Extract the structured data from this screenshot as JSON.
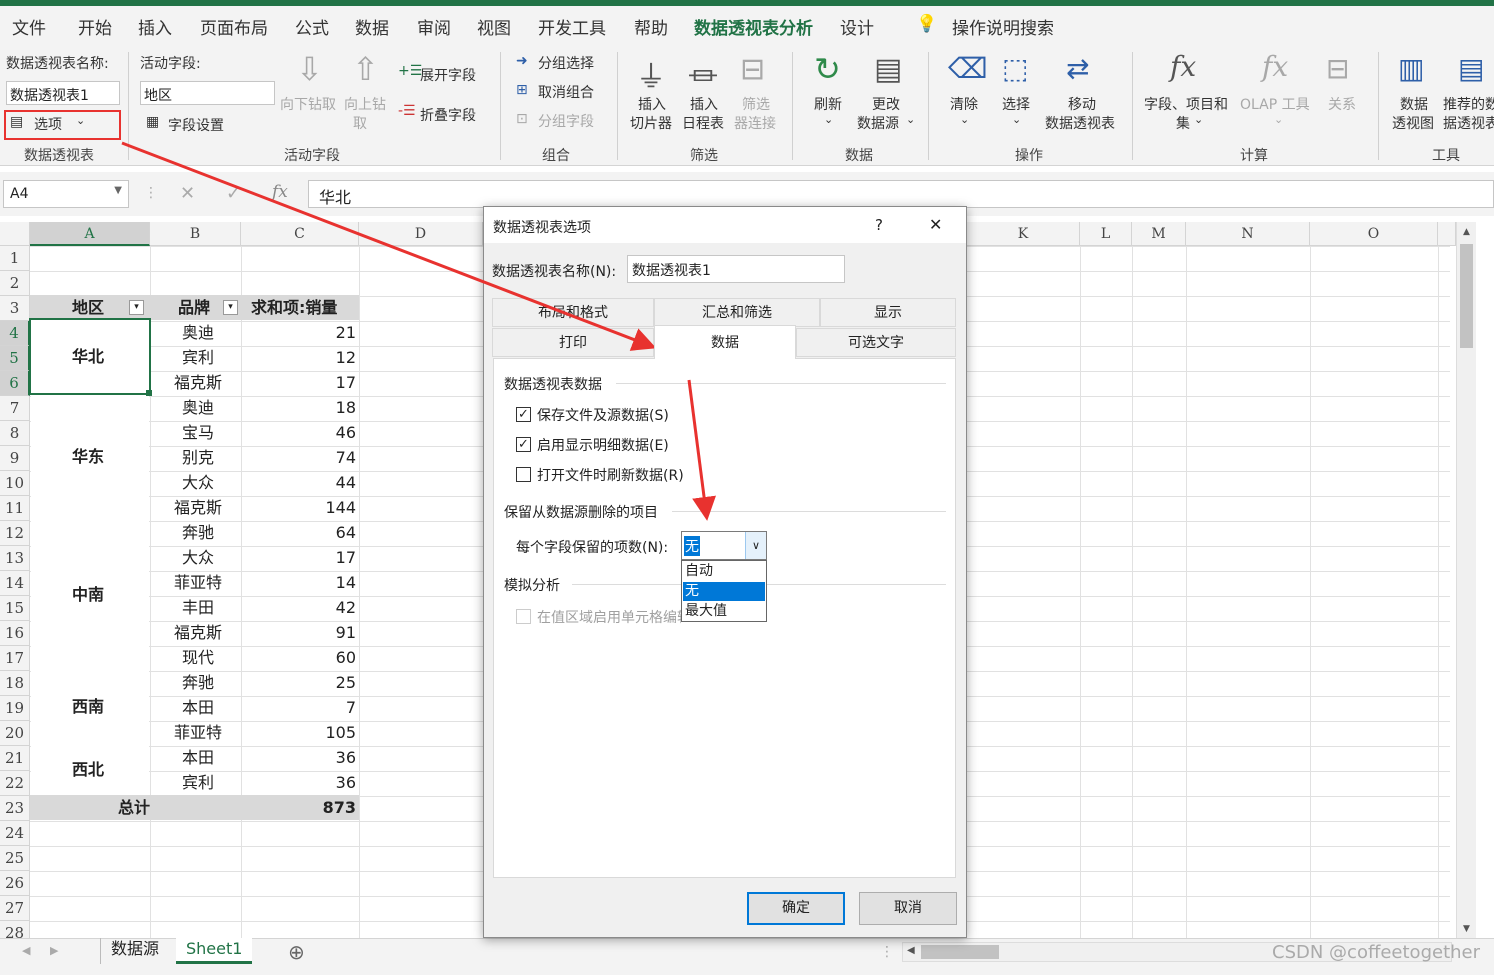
{
  "menu": {
    "items": [
      "文件",
      "开始",
      "插入",
      "页面布局",
      "公式",
      "数据",
      "审阅",
      "视图",
      "开发工具",
      "帮助",
      "数据透视表分析",
      "设计"
    ],
    "active": "数据透视表分析",
    "search": "操作说明搜索"
  },
  "ribbon": {
    "pivot_name_label": "数据透视表名称:",
    "pivot_name_value": "数据透视表1",
    "options_button": "选项",
    "group_pivot": "数据透视表",
    "active_field_label": "活动字段:",
    "active_field_value": "地区",
    "drill_down": "向下钻取",
    "drill_up_1": "向上钻",
    "drill_up_2": "取",
    "expand_field": "展开字段",
    "collapse_field": "折叠字段",
    "field_settings": "字段设置",
    "group_active_field": "活动字段",
    "group_selection": "分组选择",
    "ungroup": "取消组合",
    "group_field": "分组字段",
    "group_group": "组合",
    "insert_slicer_1": "插入",
    "insert_slicer_2": "切片器",
    "insert_timeline_1": "插入",
    "insert_timeline_2": "日程表",
    "filter_conn_1": "筛选",
    "filter_conn_2": "器连接",
    "group_filter": "筛选",
    "refresh": "刷新",
    "change_source_1": "更改",
    "change_source_2": "数据源",
    "group_data": "数据",
    "clear": "清除",
    "select": "选择",
    "move_1": "移动",
    "move_2": "数据透视表",
    "group_actions": "操作",
    "fields_items_1": "字段、项目和",
    "fields_items_2": "集",
    "olap": "OLAP 工具",
    "relationships": "关系",
    "group_calc": "计算",
    "pivot_chart_1": "数据",
    "pivot_chart_2": "透视图",
    "recommended_1": "推荐的数",
    "recommended_2": "据透视表",
    "group_tools": "工具"
  },
  "formula_bar": {
    "name_box": "A4",
    "formula": "华北"
  },
  "columns": [
    "A",
    "B",
    "C",
    "D",
    "K",
    "L",
    "M",
    "N",
    "O"
  ],
  "rows": [
    "1",
    "2",
    "3",
    "4",
    "5",
    "6",
    "7",
    "8",
    "9",
    "10",
    "11",
    "12",
    "13",
    "14",
    "15",
    "16",
    "17",
    "18",
    "19",
    "20",
    "21",
    "22",
    "23",
    "24",
    "25",
    "26",
    "27",
    "28"
  ],
  "pivot": {
    "header_region": "地区",
    "header_brand": "品牌",
    "header_sum": "求和项:销量",
    "regions": [
      "华北",
      "华东",
      "中南",
      "西南",
      "西北"
    ],
    "brands": [
      "奥迪",
      "宾利",
      "福克斯",
      "奥迪",
      "宝马",
      "别克",
      "大众",
      "福克斯",
      "奔驰",
      "大众",
      "菲亚特",
      "丰田",
      "福克斯",
      "现代",
      "奔驰",
      "本田",
      "菲亚特",
      "本田",
      "宾利"
    ],
    "values": [
      "21",
      "12",
      "17",
      "18",
      "46",
      "74",
      "44",
      "144",
      "64",
      "17",
      "14",
      "42",
      "91",
      "60",
      "25",
      "7",
      "105",
      "36",
      "36"
    ],
    "total_label": "总计",
    "total_value": "873"
  },
  "sheets": [
    "数据源",
    "Sheet1"
  ],
  "active_sheet": "Sheet1",
  "dialog": {
    "title": "数据透视表选项",
    "help": "?",
    "close": "✕",
    "name_label": "数据透视表名称(N):",
    "name_value": "数据透视表1",
    "tabs_row1": [
      "布局和格式",
      "汇总和筛选",
      "显示"
    ],
    "tabs_row2": [
      "打印",
      "数据",
      "可选文字"
    ],
    "active_tab": "数据",
    "section_data": "数据透视表数据",
    "chk_save": "保存文件及源数据(S)",
    "chk_save_checked": true,
    "chk_details": "启用显示明细数据(E)",
    "chk_details_checked": true,
    "chk_refresh": "打开文件时刷新数据(R)",
    "chk_refresh_checked": false,
    "section_retain": "保留从数据源删除的项目",
    "items_label": "每个字段保留的项数(N):",
    "items_value": "无",
    "options": [
      "自动",
      "无",
      "最大值"
    ],
    "selected_option": "无",
    "section_whatif": "模拟分析",
    "chk_whatif": "在值区域启用单元格编辑",
    "ok": "确定",
    "cancel": "取消"
  },
  "watermark": "CSDN @coffeetogether",
  "colors": {
    "excel_green": "#217346",
    "annotation_red": "#e8322f",
    "selection_blue": "#0078d7"
  }
}
